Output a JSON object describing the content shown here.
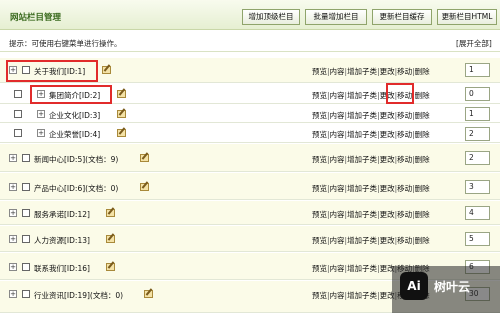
{
  "header": {
    "title": "网站栏目管理",
    "buttons": [
      "增加顶级栏目",
      "批量增加栏目",
      "更新栏目缓存",
      "更新栏目HTML"
    ]
  },
  "tip": {
    "text": "提示：可使用右键菜单进行操作。",
    "expand_all": "[展开全部]"
  },
  "ops": [
    "预览",
    "内容",
    "增加子类",
    "更改",
    "移动",
    "删除"
  ],
  "rows": [
    {
      "name": "关于我们[ID:1]",
      "order": "1"
    },
    {
      "name": "集团简介[ID:2]",
      "order": "0"
    },
    {
      "name": "企业文化[ID:3]",
      "order": "1"
    },
    {
      "name": "企业荣誉[ID:4]",
      "order": "2"
    },
    {
      "name": "新闻中心[ID:5](文档：9)",
      "order": "2"
    },
    {
      "name": "产品中心[ID:6](文档：0)",
      "order": "3"
    },
    {
      "name": "服务承诺[ID:12]",
      "order": "4"
    },
    {
      "name": "人力资源[ID:13]",
      "order": "5"
    },
    {
      "name": "联系我们[ID:16]",
      "order": "6"
    },
    {
      "name": "行业资讯[ID:19](文档：0)",
      "order": "30"
    }
  ],
  "watermark": {
    "logo": "Ai",
    "text": "树叶云"
  },
  "colors": {
    "highlight": "#e12b2b",
    "title": "#3a6a1e"
  }
}
